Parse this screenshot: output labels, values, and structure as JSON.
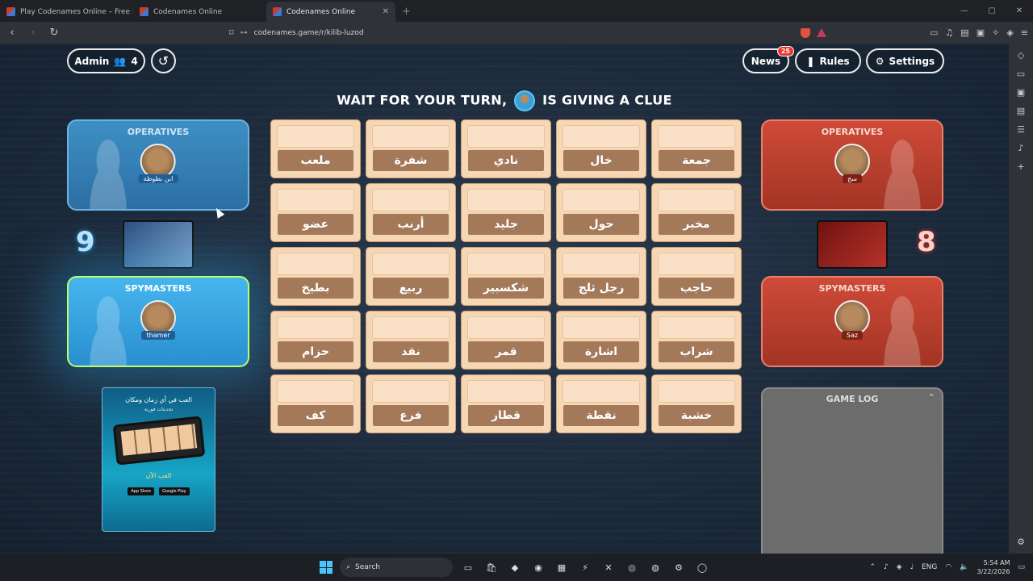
{
  "browser": {
    "tabs": [
      {
        "title": "Play Codenames Online – Free Brows",
        "active": false
      },
      {
        "title": "Codenames Online",
        "active": false
      },
      {
        "title": "Codenames Online",
        "active": true
      }
    ],
    "new_tab": "+",
    "url": "codenames.game/r/kilib-luzod"
  },
  "toolbar": {
    "admin_label": "Admin",
    "player_count": "4",
    "news_label": "News",
    "news_badge": "25",
    "rules_label": "Rules",
    "settings_label": "Settings"
  },
  "status": {
    "prefix": "WAIT FOR YOUR TURN,",
    "suffix": "IS GIVING A CLUE",
    "avatar_name": "thamer"
  },
  "blue_team": {
    "operatives_label": "OPERATIVES",
    "operative_name": "ابن بطوطة",
    "score": "9",
    "spymasters_label": "SPYMASTERS",
    "spymaster_name": "thamer",
    "color": "#2c8fd0"
  },
  "red_team": {
    "operatives_label": "OPERATIVES",
    "operative_name": "سح",
    "score": "8",
    "spymasters_label": "SPYMASTERS",
    "spymaster_name": "Saz",
    "color": "#c6402f"
  },
  "board": {
    "cards": [
      "ملعب",
      "شفرة",
      "نادي",
      "خال",
      "جمعة",
      "عضو",
      "أرنب",
      "جليد",
      "حول",
      "مخبر",
      "بطيخ",
      "ربيع",
      "شكسبير",
      "رجل ثلج",
      "حاجب",
      "حزام",
      "نقد",
      "قمر",
      "اشارة",
      "شراب",
      "كف",
      "فرع",
      "قطار",
      "نقطة",
      "خشبة"
    ]
  },
  "ad": {
    "headline": "العب في أي زمان ومكان",
    "subline": "تحديثات فورية",
    "cta": "العب الآن",
    "store1": "App Store",
    "store2": "Google Play"
  },
  "game_log": {
    "title": "GAME LOG"
  },
  "taskbar": {
    "search_placeholder": "Search",
    "language": "ENG",
    "time": "5:54 AM",
    "date": "3/22/2026"
  }
}
